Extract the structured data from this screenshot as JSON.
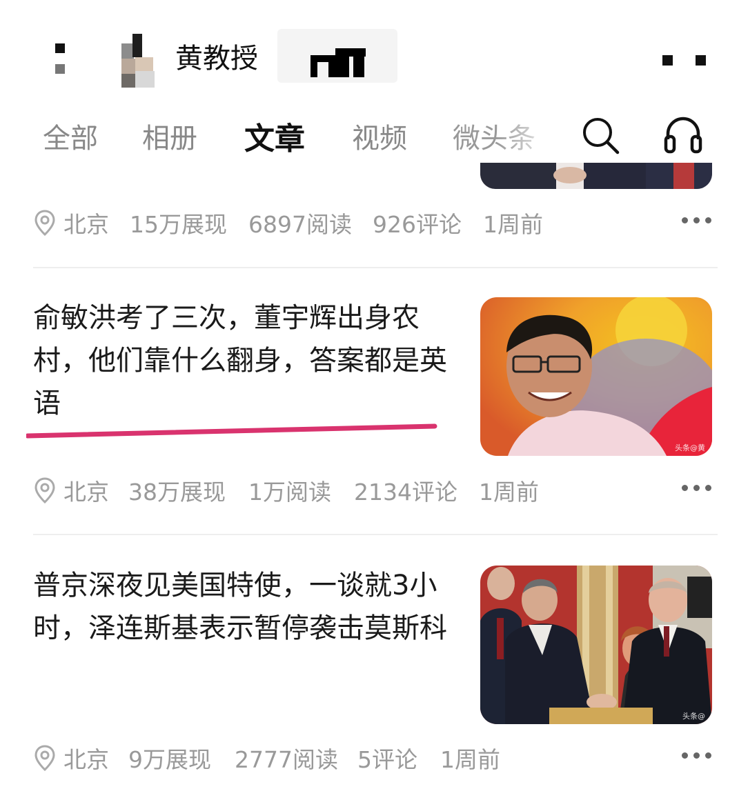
{
  "header": {
    "author_name": "黄教授",
    "back_icon": "back-icon",
    "more_icon": "more-icon"
  },
  "tabs": [
    {
      "label": "全部",
      "active": false
    },
    {
      "label": "相册",
      "active": false
    },
    {
      "label": "文章",
      "active": true
    },
    {
      "label": "视频",
      "active": false
    },
    {
      "label": "微头条",
      "active": false
    }
  ],
  "toolbar": {
    "search_icon": "search-icon",
    "headset_icon": "headset-icon"
  },
  "articles": [
    {
      "title": "",
      "location": "北京",
      "views": "15万展现",
      "reads": "6897阅读",
      "comments": "926评论",
      "time": "1周前"
    },
    {
      "title": "俞敏洪考了三次，董宇辉出身农村，他们靠什么翻身，答案都是英语",
      "location": "北京",
      "views": "38万展现",
      "reads": "1万阅读",
      "comments": "2134评论",
      "time": "1周前",
      "watermark": "头条@黄"
    },
    {
      "title": "普京深夜见美国特使，一谈就3小时，泽连斯基表示暂停袭击莫斯科",
      "location": "北京",
      "views": "9万展现",
      "reads": "2777阅读",
      "comments": "5评论",
      "time": "1周前",
      "watermark": "头条@"
    }
  ],
  "colors": {
    "underline_mark": "#d9336e",
    "meta_text": "#999999",
    "active_tab": "#111111",
    "inactive_tab": "#888888"
  }
}
